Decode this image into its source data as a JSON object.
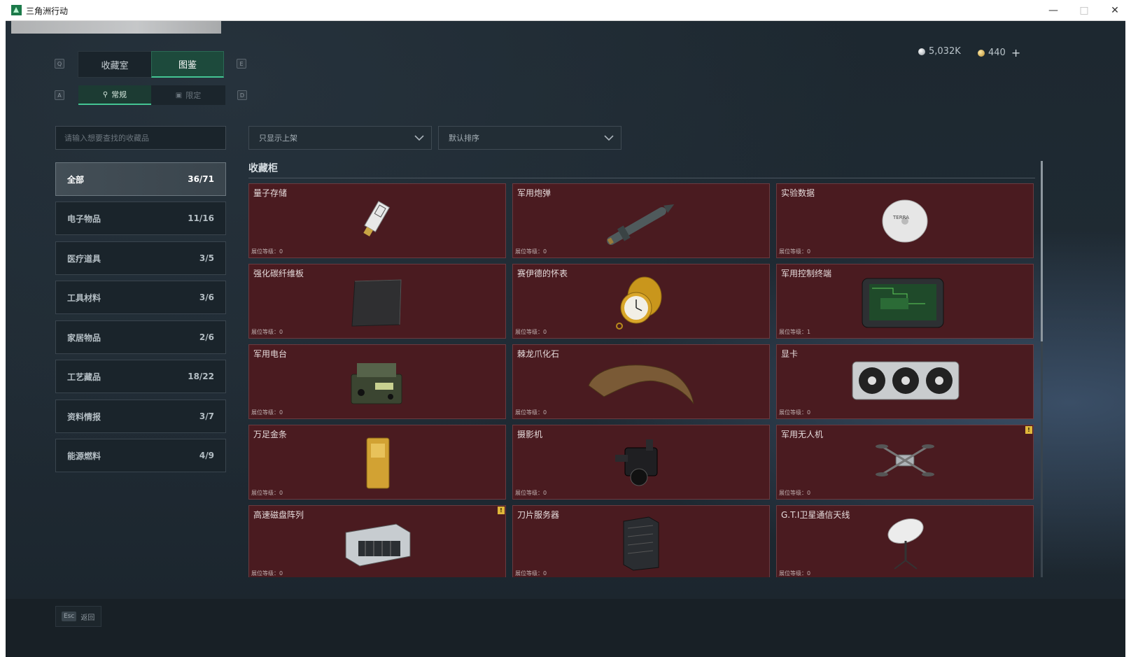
{
  "window": {
    "title": "三角洲行动",
    "min_icon": "minimize-icon",
    "max_icon": "maximize-icon",
    "close_icon": "close-icon"
  },
  "hotkeys": {
    "tab_prev": "Q",
    "tab_next": "E",
    "sub_prev": "A",
    "sub_next": "D",
    "back": "Esc"
  },
  "tabs": [
    {
      "label": "收藏室",
      "active": false
    },
    {
      "label": "图鉴",
      "active": true
    }
  ],
  "subtabs": [
    {
      "label": "常规",
      "icon": "trophy-icon",
      "active": true
    },
    {
      "label": "限定",
      "icon": "image-icon",
      "active": false
    }
  ],
  "currency": {
    "silver": "5,032K",
    "gold": "440",
    "add": "+"
  },
  "search": {
    "placeholder": "请输入想要查找的收藏品",
    "value": ""
  },
  "filters": {
    "display": "只显示上架",
    "sort": "默认排序"
  },
  "categories": [
    {
      "label": "全部",
      "count": "36/71",
      "active": true
    },
    {
      "label": "电子物品",
      "count": "11/16"
    },
    {
      "label": "医疗道具",
      "count": "3/5"
    },
    {
      "label": "工具材料",
      "count": "3/6"
    },
    {
      "label": "家居物品",
      "count": "2/6"
    },
    {
      "label": "工艺藏品",
      "count": "18/22"
    },
    {
      "label": "资料情报",
      "count": "3/7"
    },
    {
      "label": "能源燃料",
      "count": "4/9"
    }
  ],
  "section": {
    "title": "收藏柜"
  },
  "items": [
    {
      "name": "量子存储",
      "level": "展位等级：0",
      "icon": "quantum-storage-icon"
    },
    {
      "name": "军用炮弹",
      "level": "展位等级：0",
      "icon": "artillery-shell-icon"
    },
    {
      "name": "实验数据",
      "level": "展位等级：0",
      "icon": "data-disc-icon"
    },
    {
      "name": "强化碳纤维板",
      "level": "展位等级：0",
      "icon": "carbon-plate-icon"
    },
    {
      "name": "赛伊德的怀表",
      "level": "展位等级：0",
      "icon": "pocket-watch-icon"
    },
    {
      "name": "军用控制终端",
      "level": "展位等级：1",
      "icon": "control-terminal-icon"
    },
    {
      "name": "军用电台",
      "level": "展位等级：0",
      "icon": "military-radio-icon"
    },
    {
      "name": "棘龙爪化石",
      "level": "展位等级：0",
      "icon": "claw-fossil-icon"
    },
    {
      "name": "显卡",
      "level": "展位等级：0",
      "icon": "graphics-card-icon"
    },
    {
      "name": "万足金条",
      "level": "展位等级：0",
      "icon": "gold-bar-icon"
    },
    {
      "name": "摄影机",
      "level": "展位等级：0",
      "icon": "camera-icon"
    },
    {
      "name": "军用无人机",
      "level": "展位等级：0",
      "icon": "drone-icon",
      "badge": "!"
    },
    {
      "name": "高速磁盘阵列",
      "level": "展位等级：0",
      "icon": "disk-array-icon",
      "badge": "!"
    },
    {
      "name": "刀片服务器",
      "level": "展位等级：0",
      "icon": "blade-server-icon"
    },
    {
      "name": "G.T.I卫星通信天线",
      "level": "展位等级：0",
      "icon": "satellite-antenna-icon"
    }
  ],
  "footer": {
    "back_label": "返回"
  },
  "colors": {
    "accent": "#44c493",
    "card_bg": "#4a1b20",
    "badge": "#e0b73a"
  }
}
